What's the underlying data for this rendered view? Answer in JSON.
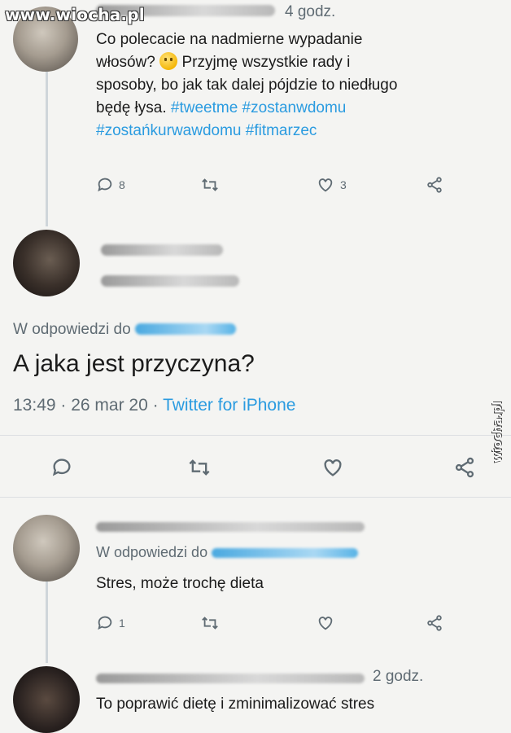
{
  "watermark": {
    "site": "www.wiocha.pl"
  },
  "side_watermark": "wiocha.pl",
  "tweet1": {
    "time": "4 godz.",
    "lines": [
      "Co polecacie na nadmierne wypadanie",
      "włosów?",
      "Przyjmę wszystkie rady i",
      "sposoby, bo jak tak dalej pójdzie to niedługo",
      "będę łysa."
    ],
    "hashtags_line1": "#tweetme #zostanwdomu",
    "hashtags_line2": "#zostańkurwawdomu #fitmarzec",
    "reply_count": "8",
    "like_count": "3"
  },
  "tweet2": {
    "reply_prefix": "W odpowiedzi do",
    "text": "A jaka jest przyczyna?",
    "timestamp": "13:49 · 26 mar 20 · ",
    "source": "Twitter for iPhone"
  },
  "tweet3": {
    "reply_prefix": "W odpowiedzi do",
    "text": "Stres, może trochę dieta",
    "reply_count": "1"
  },
  "tweet4": {
    "time": "2 godz.",
    "text": "To poprawić dietę i zminimalizować stres"
  },
  "colors": {
    "accent": "#2a9be0",
    "meta": "#5f6b73",
    "background": "#f4f4f2"
  },
  "icons": [
    "reply-icon",
    "retweet-icon",
    "like-icon",
    "share-icon"
  ]
}
